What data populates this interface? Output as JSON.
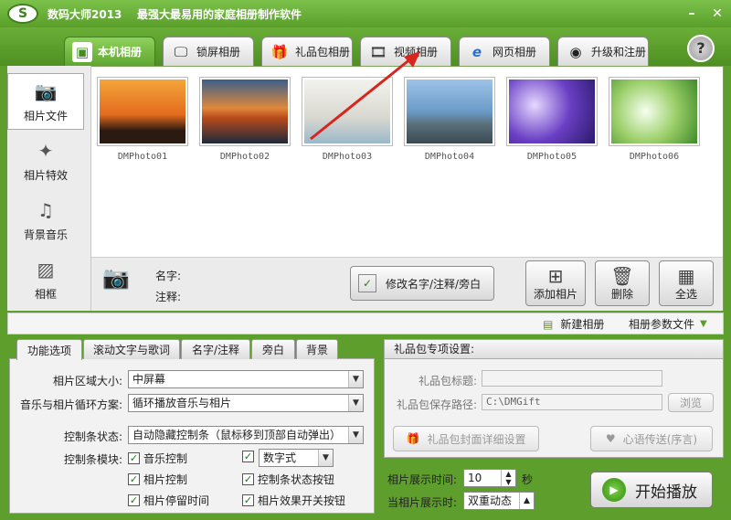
{
  "app": {
    "title": "数码大师2013",
    "slogan": "最强大最易用的家庭相册制作软件",
    "logo": "S",
    "accent": "#5a9f2a"
  },
  "tabs": [
    {
      "label": "本机相册",
      "icon": "photo-album-icon"
    },
    {
      "label": "锁屏相册",
      "icon": "monitor-icon"
    },
    {
      "label": "礼品包相册",
      "icon": "gift-icon"
    },
    {
      "label": "视频相册",
      "icon": "film-icon"
    },
    {
      "label": "网页相册",
      "icon": "ie-icon"
    },
    {
      "label": "升级和注册",
      "icon": "globe-icon"
    }
  ],
  "help_label": "?",
  "sidebar": [
    {
      "label": "相片文件",
      "icon": "camera-icon"
    },
    {
      "label": "相片特效",
      "icon": "effects-icon"
    },
    {
      "label": "背景音乐",
      "icon": "music-note-icon"
    },
    {
      "label": "相框",
      "icon": "frame-icon"
    }
  ],
  "photos": [
    "DMPhoto01",
    "DMPhoto02",
    "DMPhoto03",
    "DMPhoto04",
    "DMPhoto05",
    "DMPhoto06"
  ],
  "info": {
    "name_label": "名字:",
    "note_label": "注释:",
    "edit_button": "修改名字/注释/旁白",
    "add_button": "添加相片",
    "delete_button": "删除",
    "select_all_button": "全选"
  },
  "strip": {
    "new_album": "新建相册",
    "album_params": "相册参数文件"
  },
  "options_tabs": [
    "功能选项",
    "滚动文字与歌词",
    "名字/注释",
    "旁白",
    "背景"
  ],
  "options": {
    "area_size_label": "相片区域大小:",
    "area_size_value": "中屏幕",
    "loop_label": "音乐与相片循环方案:",
    "loop_value": "循环播放音乐与相片",
    "control_state_label": "控制条状态:",
    "control_state_value": "自动隐藏控制条（鼠标移到顶部自动弹出）",
    "control_module_label": "控制条模块:",
    "checks": [
      "音乐控制",
      "相片控制",
      "相片停留时间",
      "控制条状态按钮",
      "相片效果开关按钮"
    ],
    "digit_style_value": "数字式"
  },
  "gift": {
    "title": "礼品包专项设置:",
    "pkg_title_label": "礼品包标题:",
    "pkg_title_value": "",
    "save_path_label": "礼品包保存路径:",
    "save_path_value": "C:\\DMGift",
    "browse": "浏览",
    "cover_button": "礼品包封面详细设置",
    "message_button": "心语传送(序言)"
  },
  "timing": {
    "show_time_label": "相片展示时间:",
    "show_time_value": "10",
    "unit": "秒",
    "when_label": "当相片展示时:",
    "when_value": "双重动态"
  },
  "play_button": "开始播放"
}
